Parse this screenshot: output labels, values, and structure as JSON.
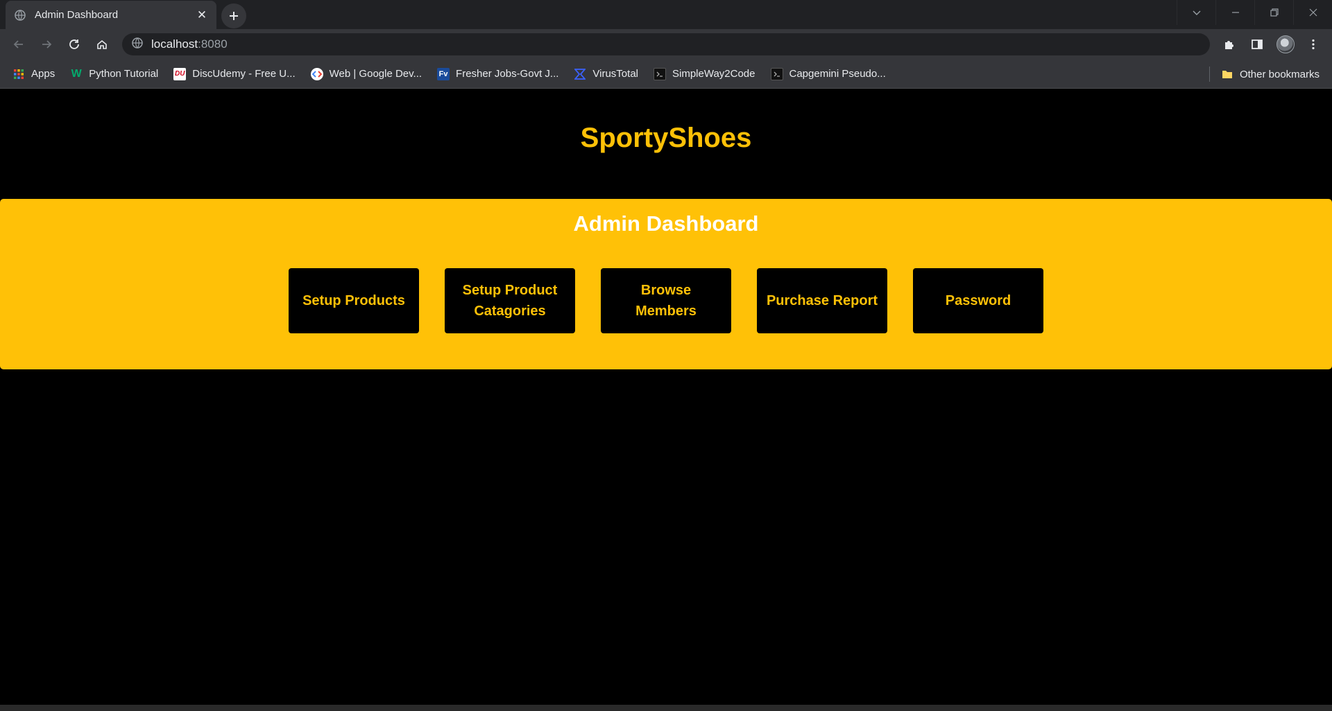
{
  "browser": {
    "tab_title": "Admin Dashboard",
    "url_host": "localhost",
    "url_port": ":8080",
    "bookmarks": [
      {
        "label": "Apps",
        "icon": "apps-grid-icon"
      },
      {
        "label": "Python Tutorial",
        "icon": "w3schools-icon"
      },
      {
        "label": "DiscUdemy - Free U...",
        "icon": "discudemy-icon"
      },
      {
        "label": "Web  |  Google Dev...",
        "icon": "google-developers-icon"
      },
      {
        "label": "Fresher Jobs-Govt J...",
        "icon": "freshersvoice-icon"
      },
      {
        "label": "VirusTotal",
        "icon": "virustotal-icon"
      },
      {
        "label": "SimpleWay2Code",
        "icon": "terminal-icon"
      },
      {
        "label": "Capgemini Pseudo...",
        "icon": "terminal-icon"
      }
    ],
    "other_bookmarks": "Other bookmarks"
  },
  "page": {
    "brand": "SportyShoes",
    "panel_title": "Admin Dashboard",
    "buttons": [
      {
        "label": "Setup Products"
      },
      {
        "label": "Setup Product Catagories"
      },
      {
        "label": "Browse Members"
      },
      {
        "label": "Purchase Report"
      },
      {
        "label": "Password"
      }
    ]
  },
  "colors": {
    "accent": "#ffc107",
    "page_bg": "#000000",
    "panel_title": "#ffffff"
  }
}
